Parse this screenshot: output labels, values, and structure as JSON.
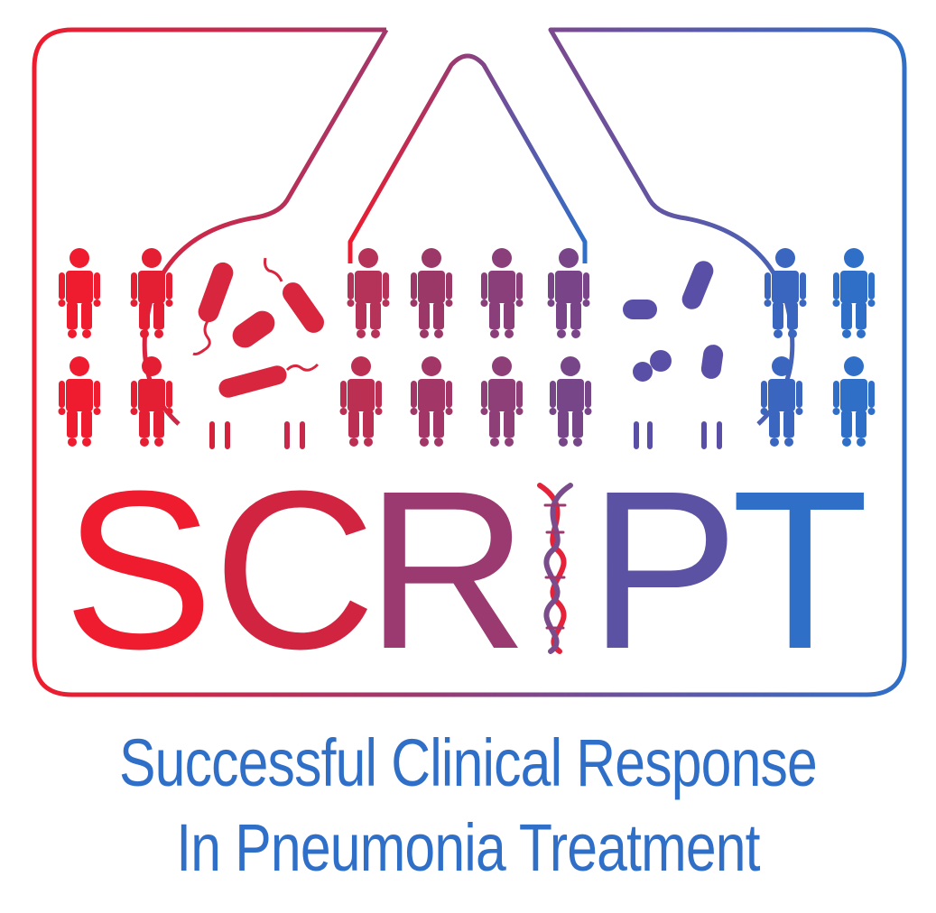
{
  "logo": {
    "letters": [
      "S",
      "C",
      "R",
      "P",
      "T"
    ],
    "tagline_line1": "Successful Clinical Response",
    "tagline_line2": "In Pneumonia Treatment"
  },
  "colors": {
    "red": "#ee1c2e",
    "crimson": "#b83456",
    "purple": "#7a4c8c",
    "violet": "#5a4fa6",
    "blue": "#2f6fc8",
    "tagline": "#2f6fc8"
  },
  "icons": {
    "people": "person-icon",
    "bacteria": "bacteria-icon",
    "dna": "dna-helix-icon",
    "lungs": "lungs-outline-icon"
  }
}
